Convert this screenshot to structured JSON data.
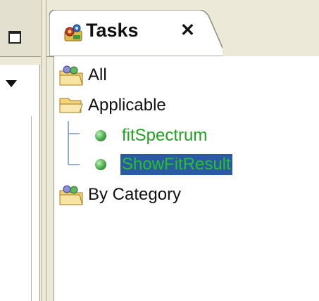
{
  "window": {
    "left_view": {
      "maximize_icon": "maximize-icon",
      "dropdown_icon": "dropdown-arrow-icon"
    },
    "tasks_view": {
      "tab_title": "Tasks",
      "tab_icon": "tasks-gear-icon",
      "close_label": "✕"
    },
    "tree": {
      "items": [
        {
          "label": "All",
          "icon": "folder-people-icon",
          "level": 0
        },
        {
          "label": "Applicable",
          "icon": "folder-open-icon",
          "level": 0
        },
        {
          "label": "fitSpectrum",
          "icon": "green-bullet-icon",
          "level": 1
        },
        {
          "label": "ShowFitResult",
          "icon": "green-bullet-icon",
          "level": 1,
          "selected": true
        },
        {
          "label": "By Category",
          "icon": "folder-people-icon",
          "level": 0
        }
      ]
    }
  }
}
